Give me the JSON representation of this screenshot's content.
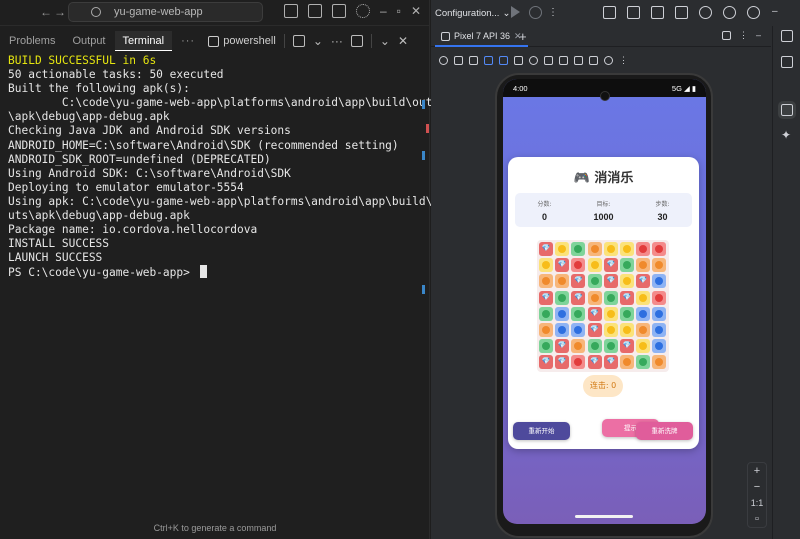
{
  "vscode": {
    "search_text": "yu-game-web-app",
    "tabs": [
      "Problems",
      "Output",
      "Terminal",
      "···"
    ],
    "active_tab": "Terminal",
    "shell_name": "powershell",
    "hint": "Ctrl+K to generate a command",
    "terminal_lines": [
      {
        "text": "BUILD SUCCESSFUL in 6s",
        "style": "ok"
      },
      {
        "text": "50 actionable tasks: 50 executed",
        "style": ""
      },
      {
        "text": "Built the following apk(s):",
        "style": ""
      },
      {
        "text": "        C:\\code\\yu-game-web-app\\platforms\\android\\app\\build\\outputs",
        "style": ""
      },
      {
        "text": "\\apk\\debug\\app-debug.apk",
        "style": ""
      },
      {
        "text": "Checking Java JDK and Android SDK versions",
        "style": ""
      },
      {
        "text": "ANDROID_HOME=C:\\software\\Android\\SDK (recommended setting)",
        "style": ""
      },
      {
        "text": "ANDROID_SDK_ROOT=undefined (DEPRECATED)",
        "style": ""
      },
      {
        "text": "Using Android SDK: C:\\software\\Android\\SDK",
        "style": ""
      },
      {
        "text": "Deploying to emulator emulator-5554",
        "style": ""
      },
      {
        "text": "Using apk: C:\\code\\yu-game-web-app\\platforms\\android\\app\\build\\outp",
        "style": ""
      },
      {
        "text": "uts\\apk\\debug\\app-debug.apk",
        "style": ""
      },
      {
        "text": "Package name: io.cordova.hellocordova",
        "style": ""
      },
      {
        "text": "INSTALL SUCCESS",
        "style": ""
      },
      {
        "text": "LAUNCH SUCCESS",
        "style": ""
      },
      {
        "text": "PS C:\\code\\yu-game-web-app> ",
        "style": "prompt"
      }
    ]
  },
  "android_studio": {
    "config_label": "Configuration...",
    "device_tab": "Pixel 7 API 36",
    "zoom_one": "1:1",
    "zoom_plus": "+",
    "zoom_minus": "−"
  },
  "phone": {
    "time": "4:00",
    "signal": "5G ◢ ▮"
  },
  "game": {
    "title": "🎮 消消乐",
    "stats": [
      {
        "label": "分数:",
        "value": "0"
      },
      {
        "label": "目标:",
        "value": "1000"
      },
      {
        "label": "步数:",
        "value": "30"
      }
    ],
    "combo": "连击: 0",
    "buttons": {
      "restart": "重新开始",
      "hint": "提示",
      "shuffle": "重新洗牌"
    },
    "colors": {
      "R": {
        "bg": "#f48b8b",
        "dot": "#e23c3c"
      },
      "Y": {
        "bg": "#fbe27a",
        "dot": "#f7bd19"
      },
      "G": {
        "bg": "#7fd49a",
        "dot": "#36a95c"
      },
      "B": {
        "bg": "#8fb3f3",
        "dot": "#2e6fe0"
      },
      "O": {
        "bg": "#f7b67a",
        "dot": "#f08a2c"
      },
      "D": {
        "bg": "#e76a6a",
        "dot": ""
      }
    },
    "grid": [
      [
        "D",
        "Y",
        "G",
        "O",
        "Y",
        "Y",
        "R",
        "R"
      ],
      [
        "Y",
        "D",
        "R",
        "Y",
        "D",
        "G",
        "O",
        "O"
      ],
      [
        "O",
        "O",
        "D",
        "G",
        "D",
        "Y",
        "D",
        "B"
      ],
      [
        "D",
        "G",
        "D",
        "O",
        "G",
        "D",
        "Y",
        "R"
      ],
      [
        "G",
        "B",
        "G",
        "D",
        "Y",
        "G",
        "B",
        "B"
      ],
      [
        "O",
        "B",
        "B",
        "D",
        "Y",
        "Y",
        "O",
        "B"
      ],
      [
        "G",
        "D",
        "O",
        "G",
        "G",
        "D",
        "Y",
        "B"
      ],
      [
        "D",
        "D",
        "R",
        "D",
        "D",
        "O",
        "G",
        "O"
      ]
    ]
  }
}
